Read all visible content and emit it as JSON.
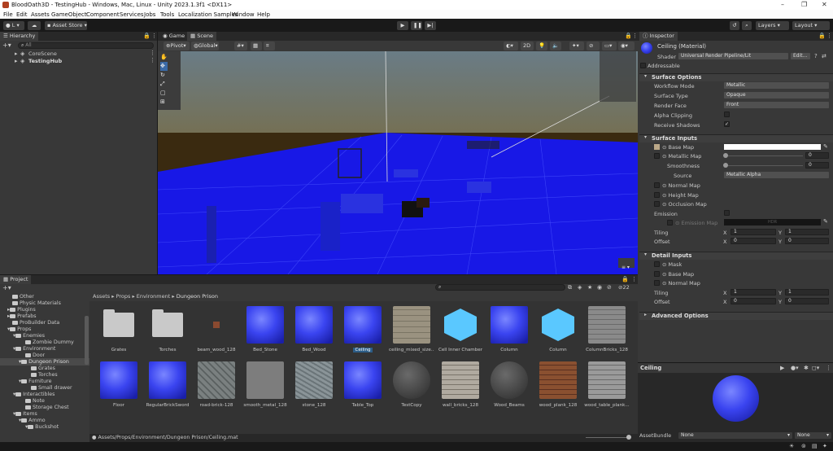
{
  "window": {
    "title": "BloodOath3D - TestingHub - Windows, Mac, Linux - Unity 2023.1.3f1 <DX11>",
    "controls": [
      "–",
      "❐",
      "✕"
    ]
  },
  "menu": [
    "File",
    "Edit",
    "Assets",
    "GameObject",
    "Component",
    "Services",
    "Jobs",
    "Tools",
    "Localization Samples",
    "Window",
    "Help"
  ],
  "toolbar": {
    "account": "L",
    "asset_store": "Asset Store",
    "layers": "Layers",
    "layout": "Layout"
  },
  "hierarchy": {
    "tab": "Hierarchy",
    "search_placeholder": "All",
    "items": [
      {
        "label": "CoreScene"
      },
      {
        "label": "TestingHub"
      }
    ]
  },
  "scene": {
    "tabs": [
      "Game",
      "Scene"
    ],
    "pivot": "Pivot",
    "global": "Global",
    "mode_2d": "2D",
    "persp_label": "≡ ▾"
  },
  "inspector": {
    "tab": "Inspector",
    "title": "Ceiling (Material)",
    "shader_label": "Shader",
    "shader_value": "Universal Render Pipeline/Lit",
    "edit_btn": "Edit...",
    "addressable": "Addressable",
    "surface_options": "Surface Options",
    "workflow_mode": {
      "label": "Workflow Mode",
      "value": "Metallic"
    },
    "surface_type": {
      "label": "Surface Type",
      "value": "Opaque"
    },
    "render_face": {
      "label": "Render Face",
      "value": "Front"
    },
    "alpha_clipping": "Alpha Clipping",
    "receive_shadows": "Receive Shadows",
    "surface_inputs": "Surface Inputs",
    "base_map": "Base Map",
    "metallic_map": {
      "label": "Metallic Map",
      "value": "0"
    },
    "smoothness": {
      "label": "Smoothness",
      "value": "0"
    },
    "source": {
      "label": "Source",
      "value": "Metallic Alpha"
    },
    "normal_map": "Normal Map",
    "height_map": "Height Map",
    "occlusion_map": "Occlusion Map",
    "emission": "Emission",
    "emission_map": "Emission Map",
    "hdr": "HDR",
    "tiling": {
      "label": "Tiling",
      "x": "1",
      "y": "1"
    },
    "offset": {
      "label": "Offset",
      "x": "0",
      "y": "0"
    },
    "detail_inputs": "Detail Inputs",
    "mask": "Mask",
    "detail_base_map": "Base Map",
    "detail_normal_map": "Normal Map",
    "d_tiling": {
      "label": "Tiling",
      "x": "1",
      "y": "1"
    },
    "d_offset": {
      "label": "Offset",
      "x": "0",
      "y": "0"
    },
    "advanced": "Advanced Options",
    "axis_x": "X",
    "axis_y": "Y"
  },
  "preview": {
    "title": "Ceiling",
    "assetbundle_label": "AssetBundle",
    "assetbundle_value": "None",
    "variant_value": "None"
  },
  "project": {
    "tab": "Project",
    "breadcrumb": [
      "Assets",
      "Props",
      "Environment",
      "Dungeon Prison"
    ],
    "count": "22",
    "status_path": "Assets/Props/Environment/Dungeon Prison/Ceiling.mat",
    "tree": [
      {
        "label": "Other",
        "indent": 0
      },
      {
        "label": "Physic Materials",
        "indent": 0
      },
      {
        "label": "Plugins",
        "indent": 0
      },
      {
        "label": "Prefabs",
        "indent": 0
      },
      {
        "label": "ProBuilder Data",
        "indent": 0
      },
      {
        "label": "Props",
        "indent": 0
      },
      {
        "label": "Enemies",
        "indent": 1
      },
      {
        "label": "Zombie Dummy",
        "indent": 2
      },
      {
        "label": "Environment",
        "indent": 1
      },
      {
        "label": "Door",
        "indent": 2
      },
      {
        "label": "Dungeon Prison",
        "indent": 2
      },
      {
        "label": "Grates",
        "indent": 3
      },
      {
        "label": "Torches",
        "indent": 3
      },
      {
        "label": "Furniture",
        "indent": 2
      },
      {
        "label": "Small drawer",
        "indent": 3
      },
      {
        "label": "Interactibles",
        "indent": 1
      },
      {
        "label": "Note",
        "indent": 2
      },
      {
        "label": "Storage Chest",
        "indent": 2
      },
      {
        "label": "Items",
        "indent": 1
      },
      {
        "label": "Ammo",
        "indent": 2
      },
      {
        "label": "Buckshot",
        "indent": 3
      }
    ],
    "assets_row1": [
      {
        "label": "Grates",
        "kind": "folder"
      },
      {
        "label": "Torches",
        "kind": "folder"
      },
      {
        "label": "beam_wood_128",
        "kind": "small"
      },
      {
        "label": "Bed_Stone",
        "kind": "sphere"
      },
      {
        "label": "Bed_Wood",
        "kind": "sphere"
      },
      {
        "label": "Ceiling",
        "kind": "sphere",
        "selected": true
      },
      {
        "label": "ceiling_mixed_size...",
        "kind": "stone"
      },
      {
        "label": "Cell Inner Chamber",
        "kind": "cube"
      },
      {
        "label": "Column",
        "kind": "sphere"
      },
      {
        "label": "Column",
        "kind": "cube"
      },
      {
        "label": "ColumnBricks_128",
        "kind": "bricktex"
      }
    ],
    "assets_row2": [
      {
        "label": "Floor",
        "kind": "sphere"
      },
      {
        "label": "RegularBrickSword",
        "kind": "sphere"
      },
      {
        "label": "road-brick-128",
        "kind": "road"
      },
      {
        "label": "smooth_metal_128",
        "kind": "metal"
      },
      {
        "label": "stone_128",
        "kind": "stonetex"
      },
      {
        "label": "Table_Top",
        "kind": "sphere"
      },
      {
        "label": "TestCopy",
        "kind": "darksphere"
      },
      {
        "label": "wall_bricks_128",
        "kind": "wallbrick"
      },
      {
        "label": "Wood_Beams",
        "kind": "darksphere"
      },
      {
        "label": "wood_plank_128",
        "kind": "wood"
      },
      {
        "label": "wood_table_plank...",
        "kind": "woodtable"
      }
    ]
  }
}
